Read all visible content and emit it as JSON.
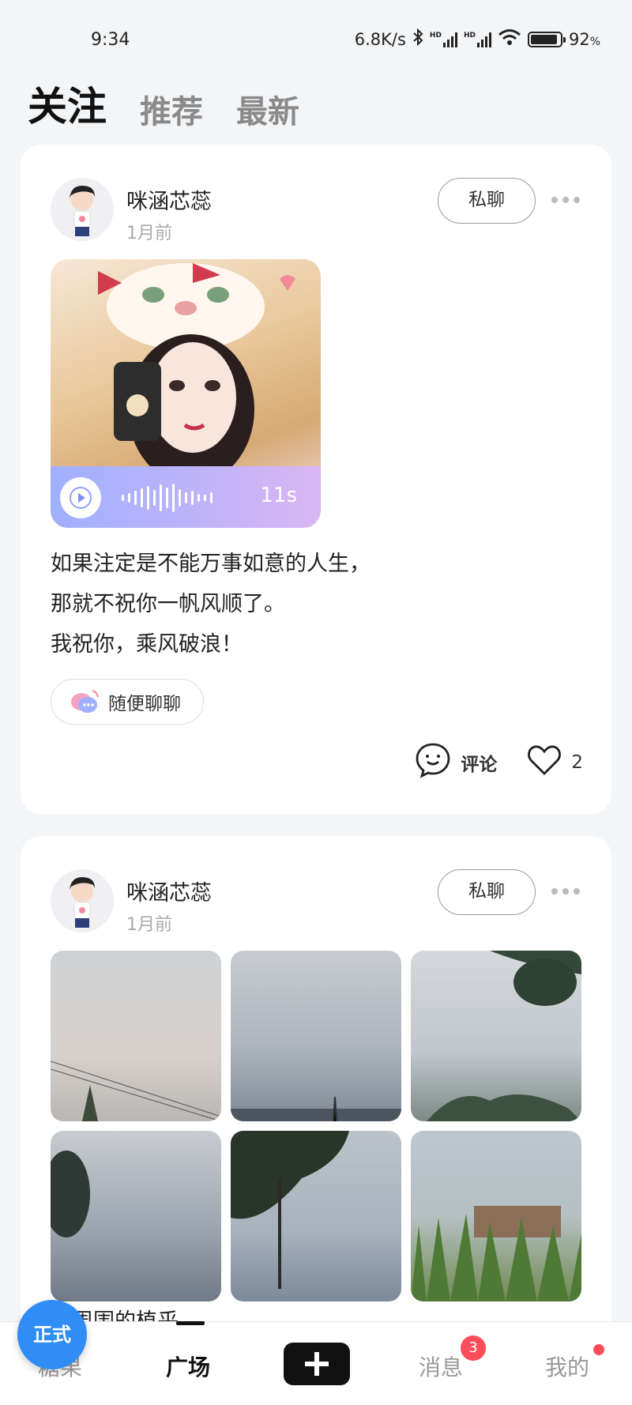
{
  "status_bar": {
    "time": "9:34",
    "net_speed": "6.8K/s",
    "network_badge_1": "HD",
    "network_badge_2": "HD",
    "battery": "92",
    "battery_unit": "%"
  },
  "tabs": [
    {
      "label": "关注",
      "active": true
    },
    {
      "label": "推荐",
      "active": false
    },
    {
      "label": "最新",
      "active": false
    }
  ],
  "posts": [
    {
      "author": "咪涵芯蕊",
      "time": "1月前",
      "dm_label": "私聊",
      "voice": {
        "duration": "11s"
      },
      "text_lines": [
        "如果注定是不能万事如意的人生，",
        "那就不祝你一帆风顺了。",
        "我祝你，乘风破浪！"
      ],
      "topic": "随便聊聊",
      "comment_label": "评论",
      "like_count": "2"
    },
    {
      "author": "咪涵芯蕊",
      "time": "1月前",
      "dm_label": "私聊",
      "photo_count": 6,
      "text_preview": "…周围的植乎"
    }
  ],
  "bottom_nav": {
    "items": [
      "糖果",
      "广场",
      "消息",
      "我的"
    ],
    "active": "广场",
    "message_badge": "3",
    "floating_label": "正式"
  },
  "colors": {
    "accent_badge": "#ff4d5a",
    "floating_button": "#2f8df5",
    "voice_gradient_start": "#9fb0ff",
    "voice_gradient_end": "#d9b6f4"
  }
}
